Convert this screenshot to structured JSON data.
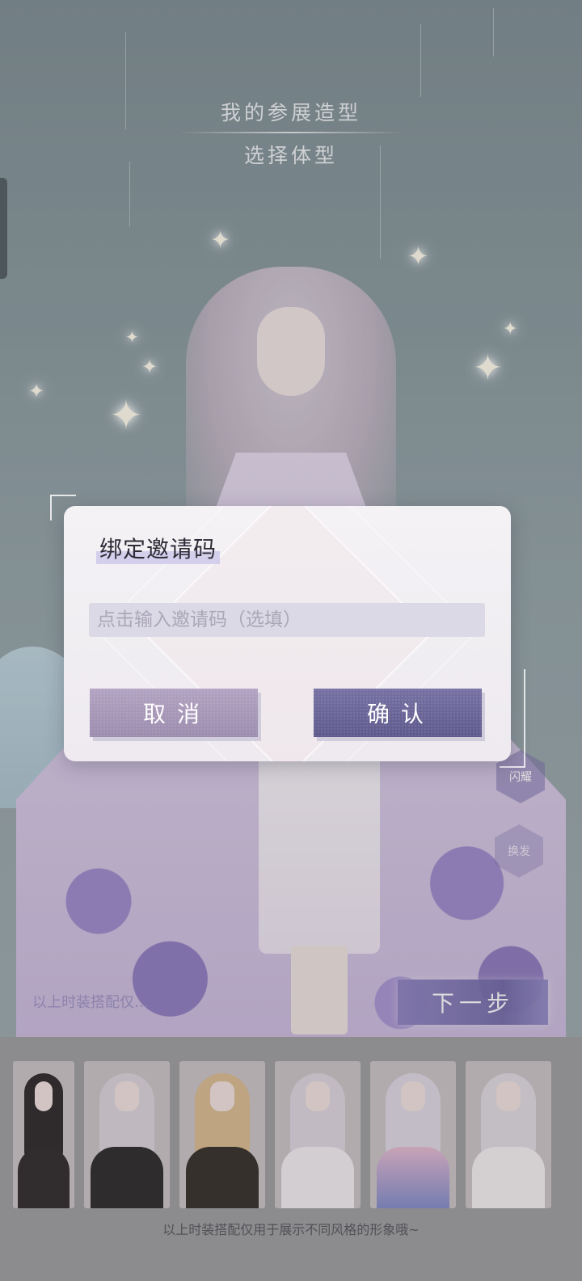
{
  "header": {
    "title": "我的参展造型",
    "subtitle": "选择体型"
  },
  "scene": {
    "next_button_label": "下一步",
    "ghost_tip": "以上时装搭配仅…",
    "side_hex_top": "闪耀",
    "side_hex_bottom": "换发"
  },
  "dialog": {
    "title": "绑定邀请码",
    "input_placeholder": "点击输入邀请码（选填）",
    "input_value": "",
    "cancel_label": "取消",
    "confirm_label": "确认"
  },
  "bottom": {
    "thumbnails": [
      {
        "name": "dark-outfit"
      },
      {
        "name": "silver-jacket"
      },
      {
        "name": "gold-dark"
      },
      {
        "name": "white-gown"
      },
      {
        "name": "floral-blue"
      },
      {
        "name": "white-lace"
      }
    ],
    "caption": "以上时装搭配仅用于展示不同风格的形象哦~"
  },
  "colors": {
    "cancel_button": "#a596b5",
    "confirm_button": "#6a6598",
    "dialog_bg": "#f2f0f3",
    "input_bg": "#dcd9e6"
  }
}
